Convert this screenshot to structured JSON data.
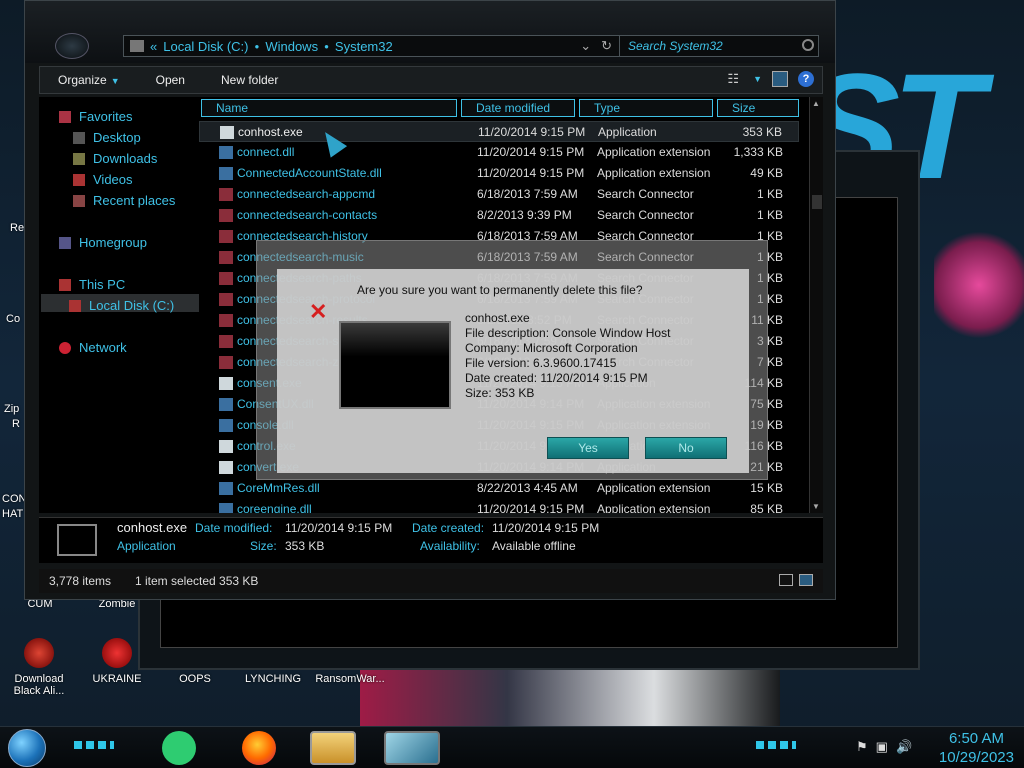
{
  "desktop": {
    "icons": [
      {
        "label": "Download Black Ali..."
      },
      {
        "label": "UKRAINE"
      },
      {
        "label": "OOPS"
      },
      {
        "label": "LYNCHING"
      },
      {
        "label": "RansomWar..."
      },
      {
        "label": "CUM"
      },
      {
        "label": "Zombie"
      }
    ],
    "left_clipped_labels": [
      "Re",
      "Co",
      "Zip",
      "R",
      "CON",
      "HAT"
    ]
  },
  "explorer": {
    "address": {
      "back_glyph": "«",
      "segments": [
        "Local Disk (C:)",
        "Windows",
        "System32"
      ]
    },
    "search_placeholder": "Search System32",
    "toolbar": {
      "organize": "Organize",
      "open": "Open",
      "new_folder": "New folder"
    },
    "nav": {
      "favorites": "Favorites",
      "desktop": "Desktop",
      "downloads": "Downloads",
      "videos": "Videos",
      "recent": "Recent places",
      "homegroup": "Homegroup",
      "this_pc": "This PC",
      "local_disk": "Local Disk (C:)",
      "network": "Network"
    },
    "columns": {
      "name": "Name",
      "date": "Date modified",
      "type": "Type",
      "size": "Size"
    },
    "files": [
      {
        "name": "conhost.exe",
        "date": "11/20/2014 9:15 PM",
        "type": "Application",
        "size": "353 KB",
        "selected": true
      },
      {
        "name": "connect.dll",
        "date": "11/20/2014 9:15 PM",
        "type": "Application extension",
        "size": "1,333 KB"
      },
      {
        "name": "ConnectedAccountState.dll",
        "date": "11/20/2014 9:15 PM",
        "type": "Application extension",
        "size": "49 KB"
      },
      {
        "name": "connectedsearch-appcmd",
        "date": "6/18/2013 7:59 AM",
        "type": "Search Connector",
        "size": "1 KB"
      },
      {
        "name": "connectedsearch-contacts",
        "date": "8/2/2013 9:39 PM",
        "type": "Search Connector",
        "size": "1 KB"
      },
      {
        "name": "connectedsearch-history",
        "date": "6/18/2013 7:59 AM",
        "type": "Search Connector",
        "size": "1 KB"
      },
      {
        "name": "connectedsearch-music",
        "date": "6/18/2013 7:59 AM",
        "type": "Search Connector",
        "size": "1 KB"
      },
      {
        "name": "connectedsearch-paths",
        "date": "6/18/2013 7:59 AM",
        "type": "Search Connector",
        "size": "1 KB"
      },
      {
        "name": "connectedsearch-protocol",
        "date": "6/18/2013 7:59 AM",
        "type": "Search Connector",
        "size": "1 KB"
      },
      {
        "name": "connectedsearch-results",
        "date": "8/2/2013 8:52 PM",
        "type": "Search Connector",
        "size": "11 KB"
      },
      {
        "name": "connectedsearch-suggestions",
        "date": "6/18/2013 7:59 AM",
        "type": "Search Connector",
        "size": "3 KB"
      },
      {
        "name": "connectedsearch-zeroinput",
        "date": "6/18/2013 7:59 AM",
        "type": "Search Connector",
        "size": "7 KB"
      },
      {
        "name": "consent.exe",
        "date": "11/20/2014 9:15 PM",
        "type": "Application",
        "size": "114 KB"
      },
      {
        "name": "ConsentUX.dll",
        "date": "11/20/2014 9:14 PM",
        "type": "Application extension",
        "size": "75 KB"
      },
      {
        "name": "console.dll",
        "date": "11/20/2014 9:15 PM",
        "type": "Application extension",
        "size": "19 KB"
      },
      {
        "name": "control.exe",
        "date": "11/20/2014 9:15 PM",
        "type": "Application",
        "size": "116 KB"
      },
      {
        "name": "convert.exe",
        "date": "11/20/2014 9:14 PM",
        "type": "Application",
        "size": "21 KB"
      },
      {
        "name": "CoreMmRes.dll",
        "date": "8/22/2013 4:45 AM",
        "type": "Application extension",
        "size": "15 KB"
      },
      {
        "name": "coreengine.dll",
        "date": "11/20/2014 9:15 PM",
        "type": "Application extension",
        "size": "85 KB"
      }
    ],
    "details": {
      "name": "conhost.exe",
      "type": "Application",
      "modified_label": "Date modified:",
      "modified_value": "11/20/2014 9:15 PM",
      "size_label": "Size:",
      "size_value": "353 KB",
      "created_label": "Date created:",
      "created_value": "11/20/2014 9:15 PM",
      "availability_label": "Availability:",
      "availability_value": "Available offline"
    },
    "status": {
      "count": "3,778 items",
      "selection": "1 item selected  353 KB"
    }
  },
  "dialog": {
    "question": "Are you sure you want to permanently delete this file?",
    "filename": "conhost.exe",
    "description": "File description: Console Window Host",
    "company": "Company: Microsoft Corporation",
    "version": "File version: 6.3.9600.17415",
    "created": "Date created: 11/20/2014 9:15 PM",
    "size": "Size: 353 KB",
    "yes": "Yes",
    "no": "No"
  },
  "taskbar": {
    "time": "6:50 AM",
    "date": "10/29/2023"
  },
  "colors": {
    "accent": "#3fc1e6",
    "dialog_button": "#1a8a8e"
  }
}
